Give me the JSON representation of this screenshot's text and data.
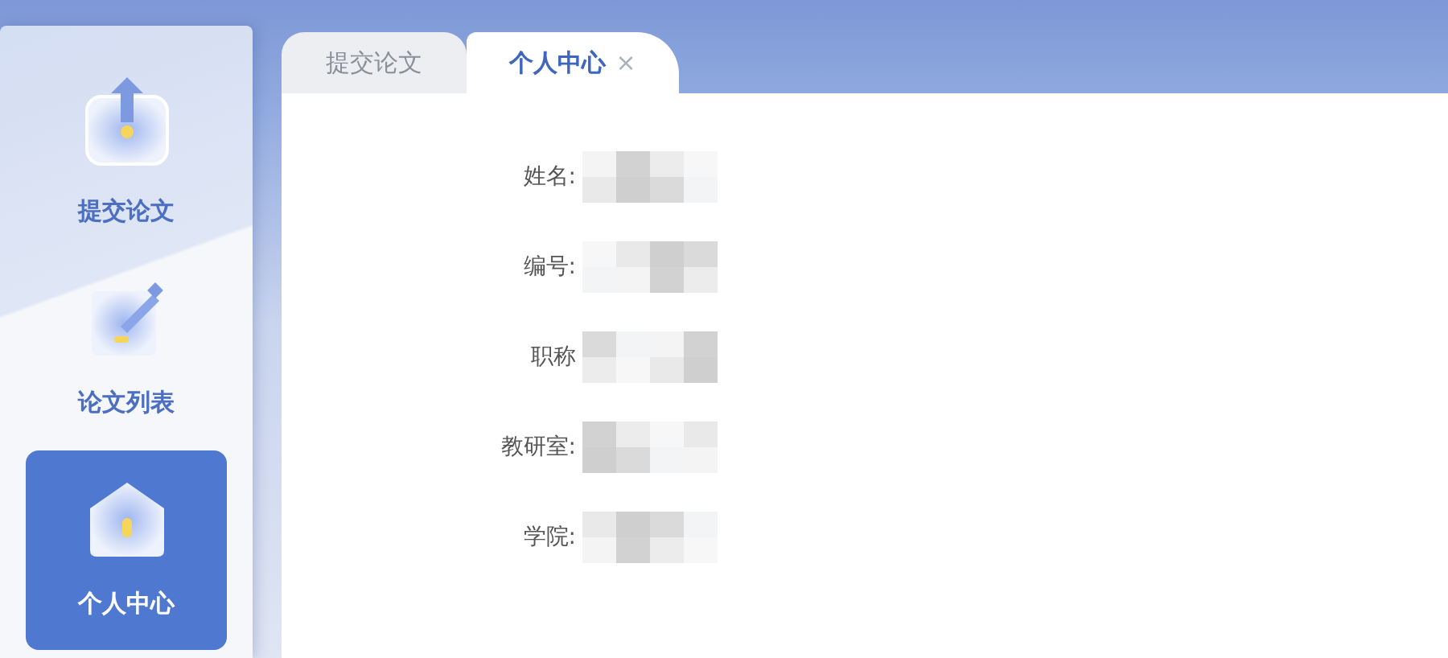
{
  "sidebar": {
    "items": [
      {
        "label": "提交论文",
        "kind": "upload",
        "selected": false
      },
      {
        "label": "论文列表",
        "kind": "edit",
        "selected": false
      },
      {
        "label": "个人中心",
        "kind": "home",
        "selected": true
      }
    ]
  },
  "tabs": [
    {
      "label": "提交论文",
      "selected": false
    },
    {
      "label": "个人中心",
      "selected": true,
      "close": "×"
    }
  ],
  "profile": {
    "fields": [
      {
        "label": "姓名:",
        "redacted": true
      },
      {
        "label": "编号:",
        "redacted": true
      },
      {
        "label": "职称",
        "redacted": true
      },
      {
        "label": "教研室:",
        "redacted": true
      },
      {
        "label": "学院:",
        "redacted": true
      }
    ]
  }
}
